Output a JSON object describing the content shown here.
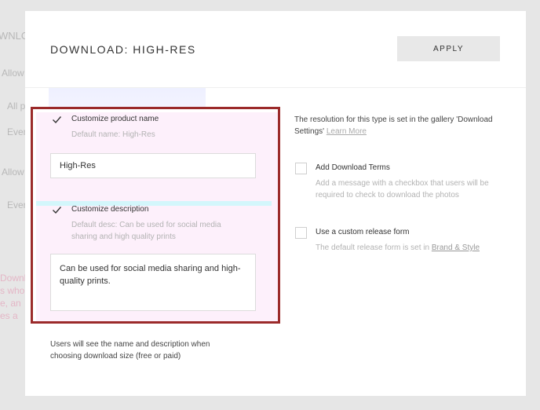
{
  "background": {
    "fragments": [
      "WNLO",
      "Allow",
      "All p",
      "Ever",
      "Allow",
      "Ever",
      "Downlo",
      "s who",
      "e, an",
      "es a"
    ]
  },
  "modal": {
    "title": "DOWNLOAD: HIGH-RES",
    "apply_label": "APPLY"
  },
  "left": {
    "product_name": {
      "checked": true,
      "label": "Customize product name",
      "default_text": "Default name: High-Res",
      "value": "High-Res"
    },
    "description": {
      "checked": true,
      "label": "Customize description",
      "default_text": "Default desc: Can be used for social media sharing and high quality prints",
      "value": "Can be used for social media sharing and high-quality prints."
    },
    "note": "Users will see the name and description when choosing download size (free or paid)"
  },
  "right": {
    "resolution_text": "The resolution for this type is set in the gallery 'Download Settings'",
    "learn_more": "Learn More",
    "download_terms": {
      "checked": false,
      "label": "Add Download Terms",
      "description": "Add a message with a checkbox that users will be required to check to download the photos"
    },
    "release_form": {
      "checked": false,
      "label": "Use a custom release form",
      "description_prefix": "The default release form is set in",
      "link": "Brand & Style"
    }
  },
  "colors": {
    "highlight_border": "#9b2a2a",
    "apply_bg": "#e8e8e8",
    "overlay_bg": "#d4d4d4"
  }
}
